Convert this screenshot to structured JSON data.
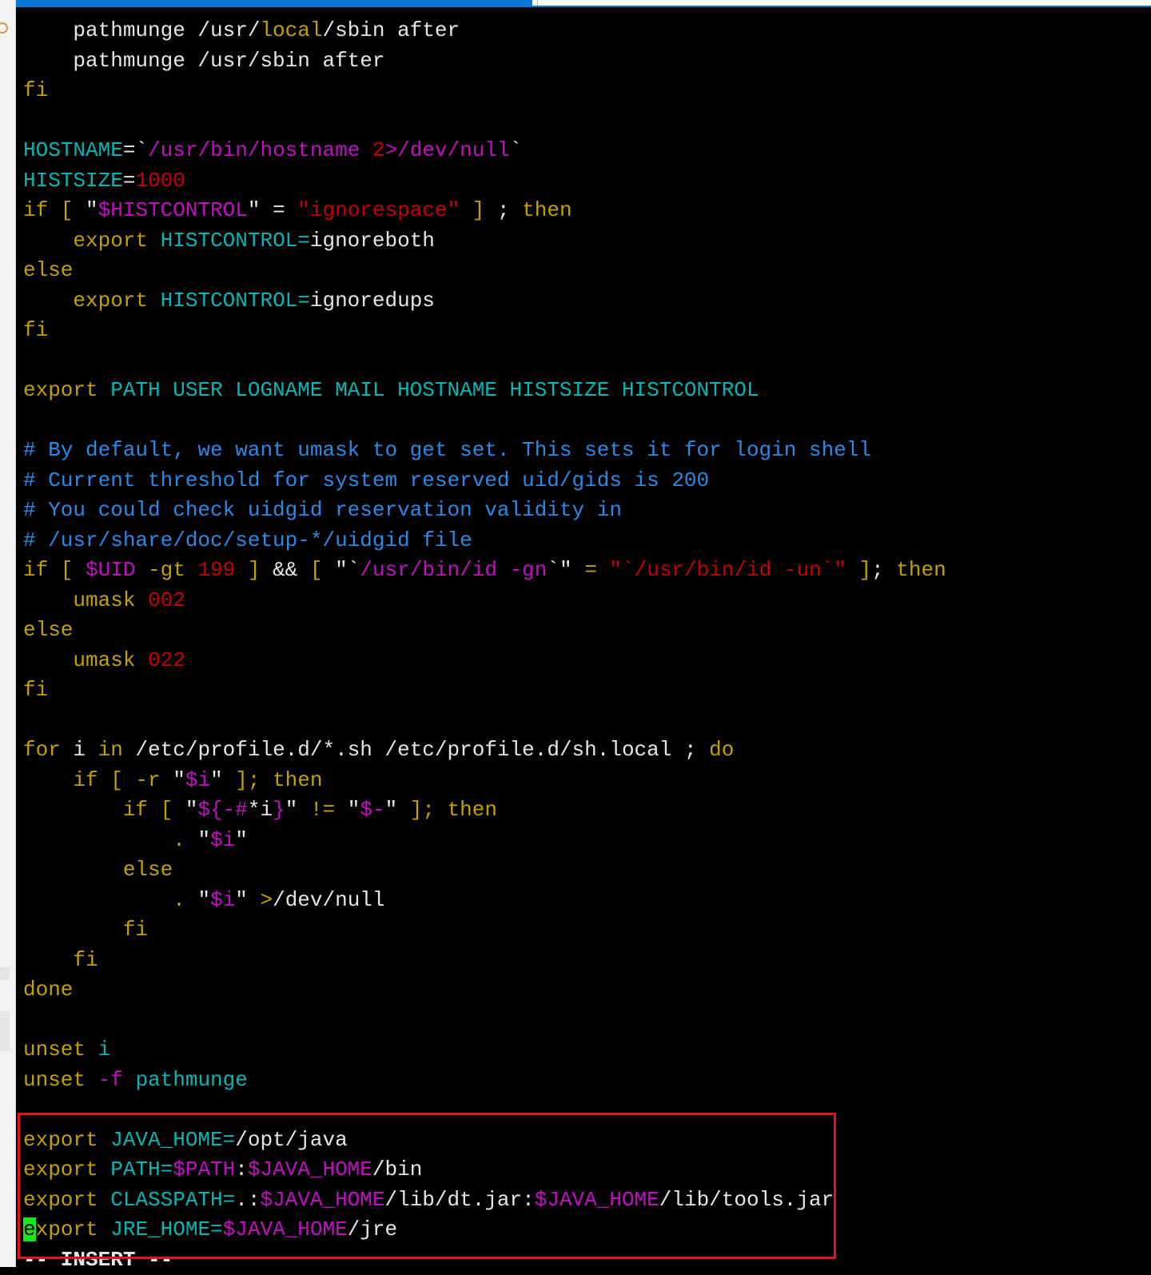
{
  "colors": {
    "y": "#c4a000",
    "w": "#e6e6e6",
    "c": "#06b6b6",
    "m": "#c20ec2",
    "r": "#c40000",
    "b": "#2a8ae6",
    "highlight": "#e0141e",
    "cursor": "#19e619",
    "tab_active": "#0a78d7"
  },
  "editor": {
    "lines": [
      {
        "segs": [
          {
            "t": "    pathmunge /usr/",
            "c": "w"
          },
          {
            "t": "local",
            "c": "y"
          },
          {
            "t": "/sbin after",
            "c": "w"
          }
        ]
      },
      {
        "segs": [
          {
            "t": "    pathmunge /usr/sbin after",
            "c": "w"
          }
        ]
      },
      {
        "segs": [
          {
            "t": "fi",
            "c": "y"
          }
        ]
      },
      {
        "segs": []
      },
      {
        "segs": [
          {
            "t": "HOSTNAME",
            "c": "c"
          },
          {
            "t": "=`",
            "c": "w"
          },
          {
            "t": "/usr/bin/hostname ",
            "c": "m"
          },
          {
            "t": "2",
            "c": "r"
          },
          {
            "t": ">/dev/null",
            "c": "m"
          },
          {
            "t": "`",
            "c": "w"
          }
        ]
      },
      {
        "segs": [
          {
            "t": "HISTSIZE",
            "c": "c"
          },
          {
            "t": "=",
            "c": "w"
          },
          {
            "t": "1000",
            "c": "r"
          }
        ]
      },
      {
        "segs": [
          {
            "t": "if [ ",
            "c": "y"
          },
          {
            "t": "\"",
            "c": "w"
          },
          {
            "t": "$HISTCONTROL",
            "c": "m"
          },
          {
            "t": "\" = ",
            "c": "w"
          },
          {
            "t": "\"ignorespace\"",
            "c": "r"
          },
          {
            "t": " ] ",
            "c": "y"
          },
          {
            "t": ";",
            "c": "w"
          },
          {
            "t": " then",
            "c": "y"
          }
        ]
      },
      {
        "segs": [
          {
            "t": "    export ",
            "c": "y"
          },
          {
            "t": "HISTCONTROL=",
            "c": "c"
          },
          {
            "t": "ignoreboth",
            "c": "w"
          }
        ]
      },
      {
        "segs": [
          {
            "t": "else",
            "c": "y"
          }
        ]
      },
      {
        "segs": [
          {
            "t": "    export ",
            "c": "y"
          },
          {
            "t": "HISTCONTROL=",
            "c": "c"
          },
          {
            "t": "ignoredups",
            "c": "w"
          }
        ]
      },
      {
        "segs": [
          {
            "t": "fi",
            "c": "y"
          }
        ]
      },
      {
        "segs": []
      },
      {
        "segs": [
          {
            "t": "export ",
            "c": "y"
          },
          {
            "t": "PATH USER LOGNAME MAIL HOSTNAME HISTSIZE HISTCONTROL",
            "c": "c"
          }
        ]
      },
      {
        "segs": []
      },
      {
        "segs": [
          {
            "t": "# By default, we want umask to get set. This sets it for login shell",
            "c": "b"
          }
        ]
      },
      {
        "segs": [
          {
            "t": "# Current threshold for system reserved uid/gids is 200",
            "c": "b"
          }
        ]
      },
      {
        "segs": [
          {
            "t": "# You could check uidgid reservation validity in",
            "c": "b"
          }
        ]
      },
      {
        "segs": [
          {
            "t": "# /usr/share/doc/setup-*/uidgid file",
            "c": "b"
          }
        ]
      },
      {
        "segs": [
          {
            "t": "if [ ",
            "c": "y"
          },
          {
            "t": "$UID",
            "c": "m"
          },
          {
            "t": " -gt ",
            "c": "y"
          },
          {
            "t": "199",
            "c": "r"
          },
          {
            "t": " ] ",
            "c": "y"
          },
          {
            "t": "&&",
            "c": "w"
          },
          {
            "t": " [ ",
            "c": "y"
          },
          {
            "t": "\"`",
            "c": "w"
          },
          {
            "t": "/usr/bin/id -gn",
            "c": "m"
          },
          {
            "t": "`\"",
            "c": "w"
          },
          {
            "t": " = ",
            "c": "y"
          },
          {
            "t": "\"`/usr/bin/id -un`\"",
            "c": "r"
          },
          {
            "t": " ]",
            "c": "y"
          },
          {
            "t": ";",
            "c": "w"
          },
          {
            "t": " then",
            "c": "y"
          }
        ]
      },
      {
        "segs": [
          {
            "t": "    umask ",
            "c": "y"
          },
          {
            "t": "002",
            "c": "r"
          }
        ]
      },
      {
        "segs": [
          {
            "t": "else",
            "c": "y"
          }
        ]
      },
      {
        "segs": [
          {
            "t": "    umask ",
            "c": "y"
          },
          {
            "t": "022",
            "c": "r"
          }
        ]
      },
      {
        "segs": [
          {
            "t": "fi",
            "c": "y"
          }
        ]
      },
      {
        "segs": []
      },
      {
        "segs": [
          {
            "t": "for ",
            "c": "y"
          },
          {
            "t": "i ",
            "c": "w"
          },
          {
            "t": "in ",
            "c": "y"
          },
          {
            "t": "/etc/profile.d/*.sh /etc/profile.d/sh.local ;",
            "c": "w"
          },
          {
            "t": " do",
            "c": "y"
          }
        ]
      },
      {
        "segs": [
          {
            "t": "    if [ -r ",
            "c": "y"
          },
          {
            "t": "\"",
            "c": "w"
          },
          {
            "t": "$i",
            "c": "m"
          },
          {
            "t": "\"",
            "c": "w"
          },
          {
            "t": " ]; then",
            "c": "y"
          }
        ]
      },
      {
        "segs": [
          {
            "t": "        if [ ",
            "c": "y"
          },
          {
            "t": "\"",
            "c": "w"
          },
          {
            "t": "${-#",
            "c": "m"
          },
          {
            "t": "*i",
            "c": "w"
          },
          {
            "t": "}",
            "c": "m"
          },
          {
            "t": "\"",
            "c": "w"
          },
          {
            "t": " != ",
            "c": "y"
          },
          {
            "t": "\"",
            "c": "w"
          },
          {
            "t": "$-",
            "c": "m"
          },
          {
            "t": "\"",
            "c": "w"
          },
          {
            "t": " ]; then",
            "c": "y"
          }
        ]
      },
      {
        "segs": [
          {
            "t": "            . ",
            "c": "y"
          },
          {
            "t": "\"",
            "c": "w"
          },
          {
            "t": "$i",
            "c": "m"
          },
          {
            "t": "\"",
            "c": "w"
          }
        ]
      },
      {
        "segs": [
          {
            "t": "        else",
            "c": "y"
          }
        ]
      },
      {
        "segs": [
          {
            "t": "            . ",
            "c": "y"
          },
          {
            "t": "\"",
            "c": "w"
          },
          {
            "t": "$i",
            "c": "m"
          },
          {
            "t": "\"",
            "c": "w"
          },
          {
            "t": " >",
            "c": "y"
          },
          {
            "t": "/dev/null",
            "c": "w"
          }
        ]
      },
      {
        "segs": [
          {
            "t": "        fi",
            "c": "y"
          }
        ]
      },
      {
        "segs": [
          {
            "t": "    fi",
            "c": "y"
          }
        ]
      },
      {
        "segs": [
          {
            "t": "done",
            "c": "y"
          }
        ]
      },
      {
        "segs": []
      },
      {
        "segs": [
          {
            "t": "unset ",
            "c": "y"
          },
          {
            "t": "i",
            "c": "c"
          }
        ]
      },
      {
        "segs": [
          {
            "t": "unset ",
            "c": "y"
          },
          {
            "t": "-f",
            "c": "m"
          },
          {
            "t": " pathmunge",
            "c": "c"
          }
        ]
      },
      {
        "segs": []
      },
      {
        "segs": [
          {
            "t": "export ",
            "c": "y"
          },
          {
            "t": "JAVA_HOME=",
            "c": "c"
          },
          {
            "t": "/opt/java",
            "c": "w"
          }
        ]
      },
      {
        "segs": [
          {
            "t": "export ",
            "c": "y"
          },
          {
            "t": "PATH=",
            "c": "c"
          },
          {
            "t": "$PATH",
            "c": "m"
          },
          {
            "t": ":",
            "c": "w"
          },
          {
            "t": "$JAVA_HOME",
            "c": "m"
          },
          {
            "t": "/bin",
            "c": "w"
          }
        ]
      },
      {
        "segs": [
          {
            "t": "export ",
            "c": "y"
          },
          {
            "t": "CLASSPATH=",
            "c": "c"
          },
          {
            "t": ".:",
            "c": "w"
          },
          {
            "t": "$JAVA_HOME",
            "c": "m"
          },
          {
            "t": "/lib/dt.jar:",
            "c": "w"
          },
          {
            "t": "$JAVA_HOME",
            "c": "m"
          },
          {
            "t": "/lib/tools.jar",
            "c": "w"
          }
        ]
      },
      {
        "segs": [
          {
            "t": "e",
            "c": "cursor"
          },
          {
            "t": "xport ",
            "c": "y"
          },
          {
            "t": "JRE_HOME=",
            "c": "c"
          },
          {
            "t": "$JAVA_HOME",
            "c": "m"
          },
          {
            "t": "/jre",
            "c": "w"
          }
        ]
      }
    ]
  },
  "status": {
    "mode": "-- INSERT --"
  }
}
